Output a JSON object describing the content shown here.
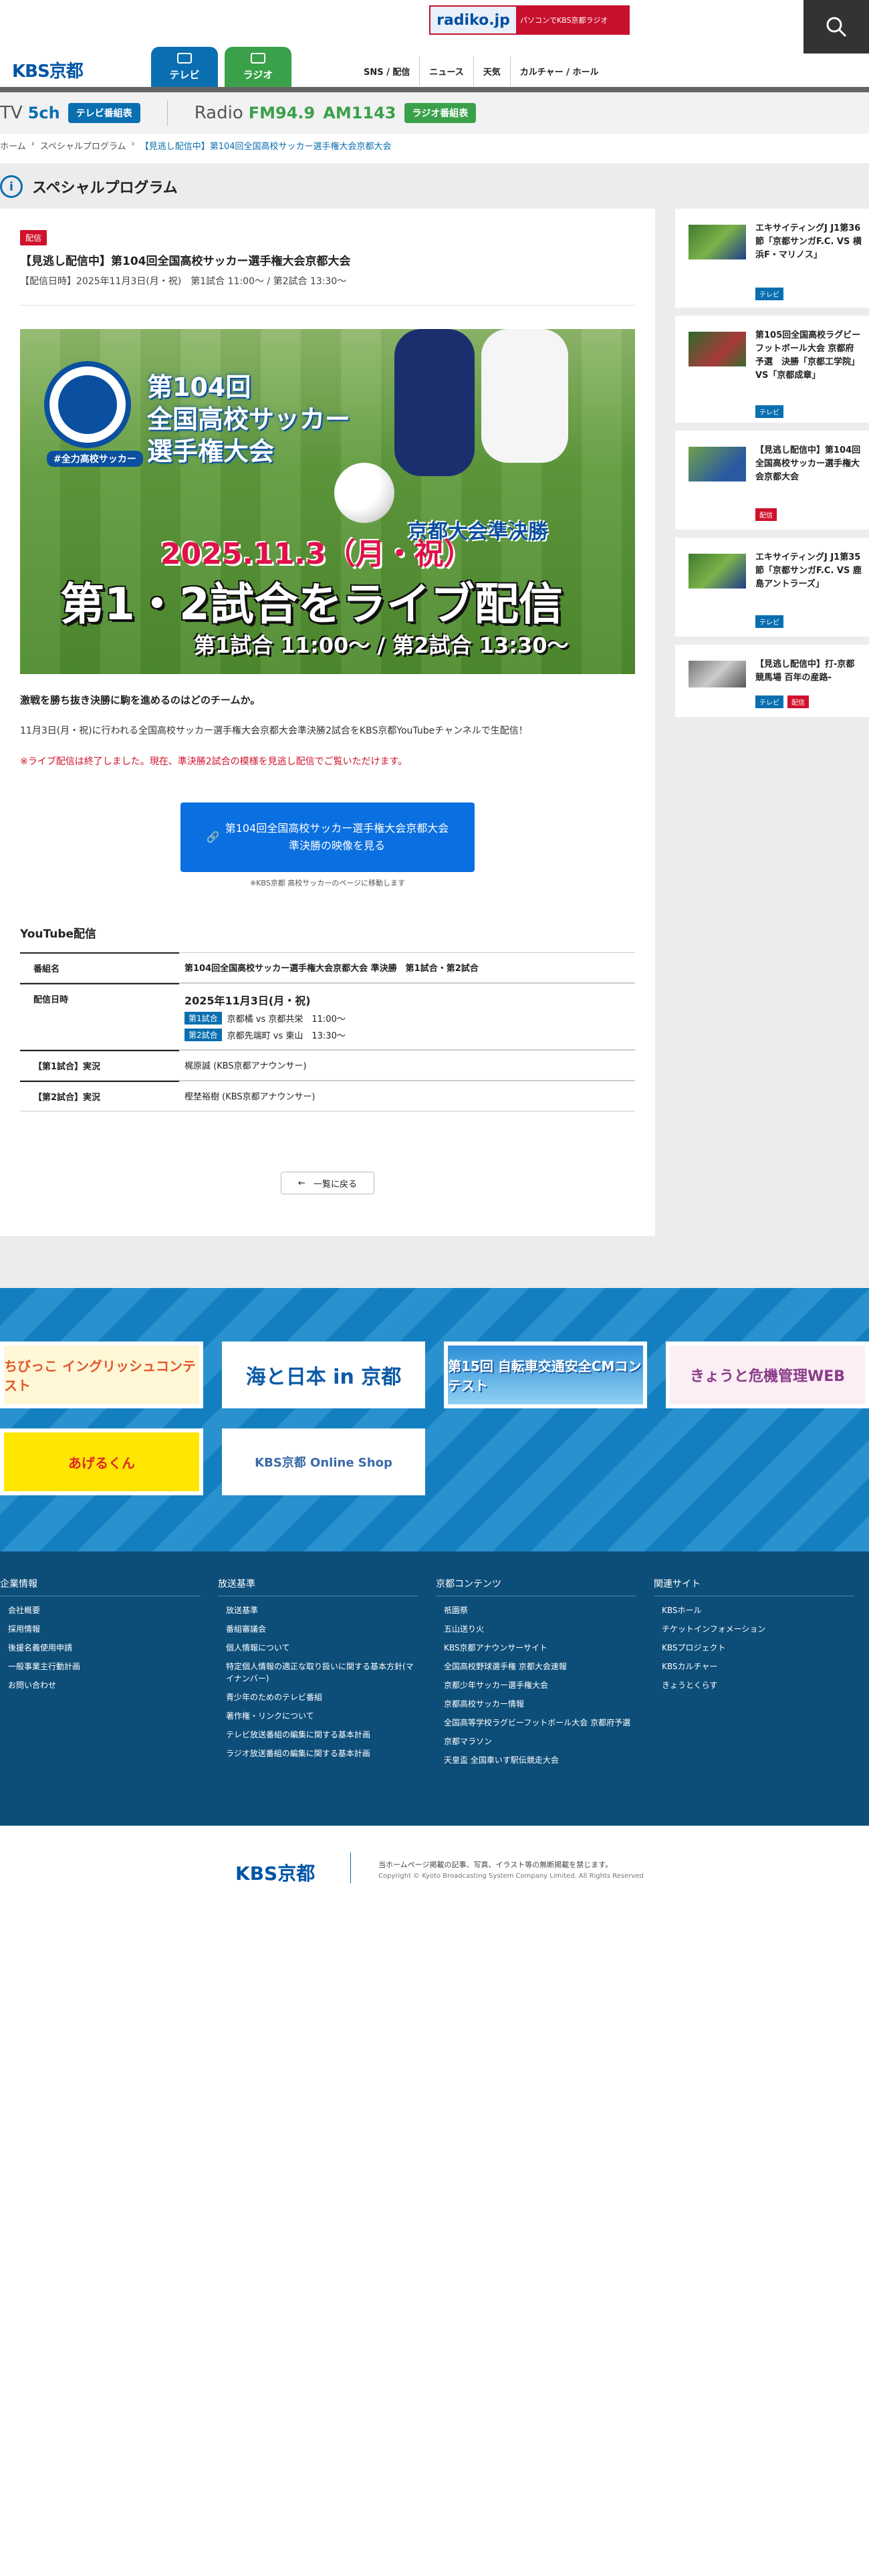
{
  "header": {
    "radiko_logo": "radiko.jp",
    "radiko_text": "パソコンでKBS京都ラジオ",
    "site_logo": "KBS京都",
    "tabs": [
      {
        "label": "テレビ"
      },
      {
        "label": "ラジオ"
      }
    ],
    "nav": [
      {
        "label": "SNS / 配信"
      },
      {
        "label": "ニュース"
      },
      {
        "label": "天気"
      },
      {
        "label": "カルチャー / ホール"
      }
    ]
  },
  "channels": {
    "tv_label": "TV",
    "tv_ch": "5ch",
    "tv_button": "テレビ番組表",
    "radio_label": "Radio",
    "fm": "FM94.9",
    "am": "AM1143",
    "radio_button": "ラジオ番組表"
  },
  "breadcrumb": [
    "ホーム",
    "スペシャルプログラム",
    "【見逃し配信中】第104回全国高校サッカー選手権大会京都大会"
  ],
  "page_title": "スペシャルプログラム",
  "article": {
    "badge": "配信",
    "title": "【見逃し配信中】第104回全国高校サッカー選手権大会京都大会",
    "date": "【配信日時】2025年11月3日(月・祝)　第1試合 11:00〜 / 第2試合 13:30〜",
    "banner": {
      "emblem_label": "#全力高校サッカー",
      "line1": "第104回",
      "line2": "全国高校サッカー",
      "line3": "選手権大会",
      "date": "2025.11.3（月・祝）",
      "round": "京都大会準決勝",
      "headline": "第1・2試合をライブ配信",
      "times": "第1試合 11:00〜 / 第2試合 13:30〜"
    },
    "lead": "激戦を勝ち抜き決勝に駒を進めるのはどのチームか。",
    "paragraph": "11月3日(月・祝)に行われる全国高校サッカー選手権大会京都大会準決勝2試合をKBS京都YouTubeチャンネルで生配信！",
    "notice": "※ライブ配信は終了しました。現在、準決勝2試合の模様を見逃し配信でご覧いただけます。",
    "cta_line1": "第104回全国高校サッカー選手権大会京都大会",
    "cta_line2": "準決勝の映像を見る",
    "cta_note": "※KBS京都 高校サッカーのページに移動します",
    "youtube_heading": "YouTube配信",
    "table": {
      "program_label": "番組名",
      "program_value": "第104回全国高校サッカー選手権大会京都大会 準決勝　第1試合・第2試合",
      "datetime_label": "配信日時",
      "datetime_value": "2025年11月3日(月・祝)",
      "match1_tag": "第1試合",
      "match1_text": "京都橘 vs 京都共栄　11:00〜",
      "match2_tag": "第2試合",
      "match2_text": "京都先端町 vs 東山　13:30〜",
      "commentary1_label": "【第1試合】実況",
      "commentary1_value": "梶原誠 (KBS京都アナウンサー)",
      "commentary2_label": "【第2試合】実況",
      "commentary2_value": "樫埜裕樹 (KBS京都アナウンサー)"
    },
    "back_label": "一覧に戻る"
  },
  "sidebar": [
    {
      "title": "エキサイティングJ J1第36節「京都サンガF.C. VS 横浜F・マリノス」",
      "tags": [
        "テレビ"
      ]
    },
    {
      "title": "第105回全国高校ラグビーフットボール大会 京都府予選　決勝「京都工学院」VS「京都成章」",
      "tags": [
        "テレビ"
      ]
    },
    {
      "title": "【見逃し配信中】第104回全国高校サッカー選手権大会京都大会",
      "tags": [
        "配信"
      ]
    },
    {
      "title": "エキサイティングJ J1第35節「京都サンガF.C. VS 鹿島アントラーズ」",
      "tags": [
        "テレビ"
      ]
    },
    {
      "title": "【見逃し配信中】打-京都競馬場 百年の産路-",
      "tags": [
        "テレビ",
        "配信"
      ]
    }
  ],
  "banners": [
    {
      "label": "ちびっこ イングリッシュコンテスト"
    },
    {
      "label": "海と日本 in 京都"
    },
    {
      "label": "第15回 自転車交通安全CMコンテスト"
    },
    {
      "label": "きょうと危機管理WEB"
    },
    {
      "label": "あげるくん"
    },
    {
      "label": "KBS京都 Online Shop"
    }
  ],
  "footer": {
    "columns": [
      {
        "title": "企業情報",
        "items": [
          "会社概要",
          "採用情報",
          "後援名義使用申請",
          "一般事業主行動計画",
          "お問い合わせ"
        ]
      },
      {
        "title": "放送基準",
        "items": [
          "放送基準",
          "番組審議会",
          "個人情報について",
          "特定個人情報の適正な取り扱いに関する基本方針(マイナンバー)",
          "青少年のためのテレビ番組",
          "著作権・リンクについて",
          "テレビ放送番組の編集に関する基本計画",
          "ラジオ放送番組の編集に関する基本計画"
        ]
      },
      {
        "title": "京都コンテンツ",
        "items": [
          "祇園祭",
          "五山送り火",
          "KBS京都アナウンサーサイト",
          "全国高校野球選手権 京都大会速報",
          "京都少年サッカー選手権大会",
          "京都高校サッカー情報",
          "全国高等学校ラグビーフットボール大会 京都府予選",
          "京都マラソン",
          "天皇盃 全国車いす駅伝競走大会"
        ]
      },
      {
        "title": "関連サイト",
        "items": [
          "KBSホール",
          "チケットインフォメーション",
          "KBSプロジェクト",
          "KBSカルチャー",
          "きょうとくらす"
        ]
      }
    ],
    "logo": "KBS京都",
    "copy1": "当ホームページ掲載の記事、写真、イラスト等の無断掲載を禁じます。",
    "copy2": "Copyright © Kyoto Broadcasting System Company Limited. All Rights Reserved"
  }
}
